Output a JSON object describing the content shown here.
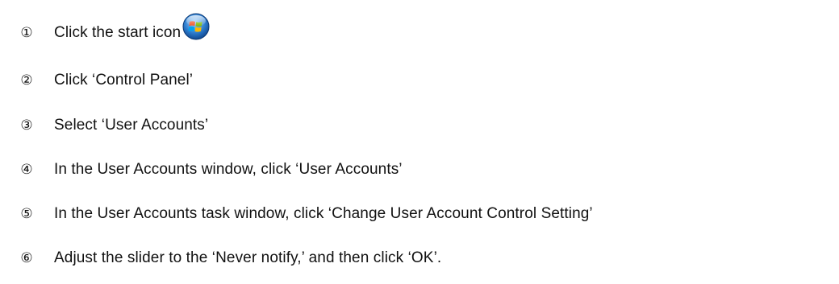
{
  "steps": [
    {
      "number": "①",
      "text": "Click the start icon",
      "icon": "windows-start-orb-icon"
    },
    {
      "number": "②",
      "text": "Click ‘Control Panel’"
    },
    {
      "number": "③",
      "text": "Select ‘User Accounts’"
    },
    {
      "number": "④",
      "text": "In the User Accounts window, click ‘User Accounts’"
    },
    {
      "number": "⑤",
      "text": "In the User Accounts task window, click ‘Change User Account Control Setting’"
    },
    {
      "number": "⑥",
      "text": "Adjust the slider to the ‘Never notify,’ and then click ‘OK’."
    }
  ]
}
